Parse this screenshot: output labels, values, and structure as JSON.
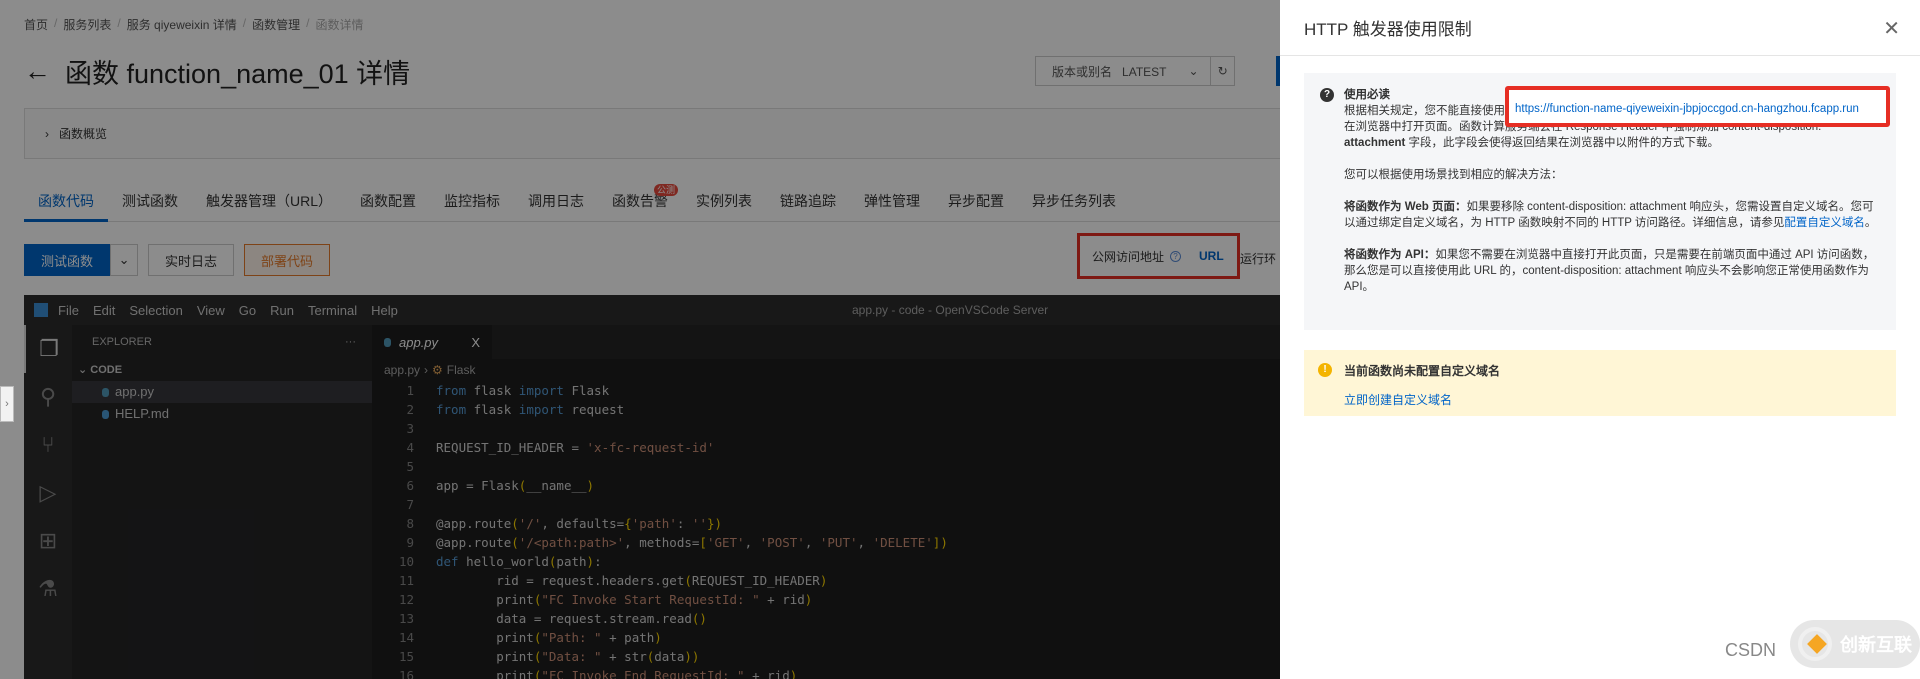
{
  "breadcrumb": [
    "首页",
    "服务列表",
    "服务 qiyeweixin 详情",
    "函数管理",
    "函数详情"
  ],
  "page_title": "函数 function_name_01 详情",
  "version": {
    "label": "版本或别名",
    "value": "LATEST"
  },
  "overview_label": "函数概览",
  "tabs": [
    {
      "label": "函数代码"
    },
    {
      "label": "测试函数"
    },
    {
      "label": "触发器管理（URL）"
    },
    {
      "label": "函数配置"
    },
    {
      "label": "监控指标"
    },
    {
      "label": "调用日志"
    },
    {
      "label": "函数告警",
      "badge": "公测"
    },
    {
      "label": "实例列表"
    },
    {
      "label": "链路追踪"
    },
    {
      "label": "弹性管理"
    },
    {
      "label": "异步配置"
    },
    {
      "label": "异步任务列表"
    }
  ],
  "buttons": {
    "test": "测试函数",
    "logs": "实时日志",
    "deploy": "部署代码"
  },
  "public_url": {
    "label": "公网访问地址",
    "link": "URL",
    "next": "运行环"
  },
  "vscode": {
    "menu": [
      "File",
      "Edit",
      "Selection",
      "View",
      "Go",
      "Run",
      "Terminal",
      "Help"
    ],
    "window_title": "app.py - code - OpenVSCode Server",
    "explorer": "EXPLORER",
    "section": "CODE",
    "files": [
      "app.py",
      "HELP.md"
    ],
    "tab": "app.py",
    "close": "X",
    "breadcrumb": [
      "app.py",
      "Flask"
    ],
    "lines": [
      [
        [
          "from",
          "kw"
        ],
        [
          " flask ",
          "pl"
        ],
        [
          "import",
          "kw"
        ],
        [
          " Flask",
          "pl"
        ]
      ],
      [
        [
          "from",
          "kw"
        ],
        [
          " flask ",
          "pl"
        ],
        [
          "import",
          "kw"
        ],
        [
          " request",
          "pl"
        ]
      ],
      [],
      [
        [
          "REQUEST_ID_HEADER = ",
          "pl"
        ],
        [
          "'x-fc-request-id'",
          "st"
        ]
      ],
      [],
      [
        [
          "app = Flask",
          "pl"
        ],
        [
          "(",
          "br"
        ],
        [
          "__name__",
          "pl"
        ],
        [
          ")",
          "br"
        ]
      ],
      [],
      [
        [
          "@app.route",
          "pl"
        ],
        [
          "(",
          "br"
        ],
        [
          "'/'",
          "st"
        ],
        [
          ", defaults=",
          "pl"
        ],
        [
          "{",
          "br"
        ],
        [
          "'path'",
          "st"
        ],
        [
          ": ",
          "pl"
        ],
        [
          "''",
          "st"
        ],
        [
          "})",
          "br"
        ]
      ],
      [
        [
          "@app.route",
          "pl"
        ],
        [
          "(",
          "br"
        ],
        [
          "'/<path:path>'",
          "st"
        ],
        [
          ", methods=",
          "pl"
        ],
        [
          "[",
          "br"
        ],
        [
          "'GET'",
          "st"
        ],
        [
          ", ",
          "pl"
        ],
        [
          "'POST'",
          "st"
        ],
        [
          ", ",
          "pl"
        ],
        [
          "'PUT'",
          "st"
        ],
        [
          ", ",
          "pl"
        ],
        [
          "'DELETE'",
          "st"
        ],
        [
          "])",
          "br"
        ]
      ],
      [
        [
          "def",
          "kw"
        ],
        [
          " hello_world",
          "pl"
        ],
        [
          "(",
          "br"
        ],
        [
          "path",
          "pl"
        ],
        [
          ")",
          "br"
        ],
        [
          ":",
          "pl"
        ]
      ],
      [
        [
          "        rid = request.headers.get",
          "pl"
        ],
        [
          "(",
          "br"
        ],
        [
          "REQUEST_ID_HEADER",
          "pl"
        ],
        [
          ")",
          "br"
        ]
      ],
      [
        [
          "        print",
          "pl"
        ],
        [
          "(",
          "br"
        ],
        [
          "\"FC Invoke Start RequestId: \"",
          "st"
        ],
        [
          " + rid",
          "pl"
        ],
        [
          ")",
          "br"
        ]
      ],
      [
        [
          "        data = request.stream.read",
          "pl"
        ],
        [
          "()",
          "br"
        ]
      ],
      [
        [
          "        print",
          "pl"
        ],
        [
          "(",
          "br"
        ],
        [
          "\"Path: \"",
          "st"
        ],
        [
          " + path",
          "pl"
        ],
        [
          ")",
          "br"
        ]
      ],
      [
        [
          "        print",
          "pl"
        ],
        [
          "(",
          "br"
        ],
        [
          "\"Data: \"",
          "st"
        ],
        [
          " + str",
          "pl"
        ],
        [
          "(",
          "br"
        ],
        [
          "data",
          "pl"
        ],
        [
          "))",
          "br"
        ]
      ],
      [
        [
          "        print",
          "pl"
        ],
        [
          "(",
          "br"
        ],
        [
          "\"FC Invoke End RequestId: \"",
          "st"
        ],
        [
          " + rid",
          "pl"
        ],
        [
          ")",
          "br"
        ]
      ]
    ]
  },
  "panel": {
    "title": "HTTP 触发器使用限制",
    "info_title": "使用必读",
    "p1_pre": "根据相关规定，您不能直接使用",
    "url": "https://function-name-qiyeweixin-jbpjoccgod.cn-hangzhou.fcapp.run",
    "p1_line2": "在浏览器中打开页面。函数计算服务端会在 Response Header 中强制添加 content-disposition:",
    "p1_bold": "attachment",
    "p1_end": " 字段，此字段会使得返回结果在浏览器中以附件的方式下载。",
    "p2": "您可以根据使用场景找到相应的解决方法：",
    "web_bold": "将函数作为 Web 页面：",
    "web_text": "如果要移除 content-disposition: attachment 响应头，您需设置自定义域名。您可以通过绑定自定义域名，为 HTTP 函数映射不同的 HTTP 访问路径。详细信息，请参见",
    "web_link": "配置自定义域名",
    "web_end": "。",
    "api_bold": "将函数作为 API：",
    "api_text": "如果您不需要在浏览器中直接打开此页面，只是需要在前端页面中通过 API 访问函数，那么您是可以直接使用此 URL 的，content-disposition: attachment 响应头不会影响您正常使用函数作为 API。",
    "warn_title": "当前函数尚未配置自定义域名",
    "warn_link": "立即创建自定义域名"
  },
  "watermark": {
    "csdn": "CSDN",
    "brand": "创新互联"
  }
}
